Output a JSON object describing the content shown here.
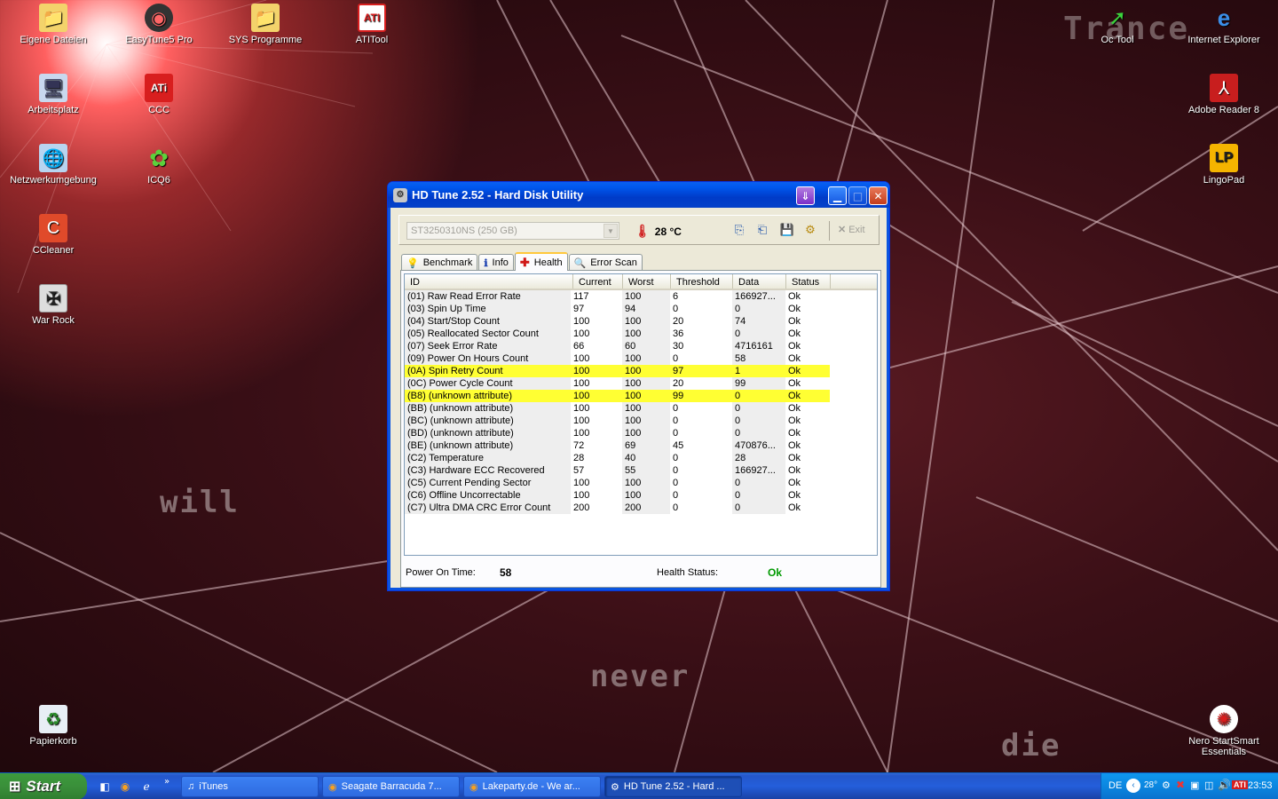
{
  "wallpaper": {
    "words": [
      "will",
      "never",
      "die"
    ],
    "top_word": "Trance"
  },
  "desktop_icons_left": [
    {
      "label": "Eigene Dateien",
      "icon": "folder-documents-icon"
    },
    {
      "label": "Arbeitsplatz",
      "icon": "computer-icon"
    },
    {
      "label": "Netzwerkumgebung",
      "icon": "network-icon"
    },
    {
      "label": "CCleaner",
      "icon": "ccleaner-icon"
    },
    {
      "label": "War Rock",
      "icon": "war-rock-icon"
    },
    {
      "label": "Papierkorb",
      "icon": "recycle-bin-icon"
    }
  ],
  "desktop_icons_col2": [
    {
      "label": "EasyTune5 Pro",
      "icon": "easytune-icon"
    },
    {
      "label": "CCC",
      "icon": "ati-ccc-icon"
    },
    {
      "label": "ICQ6",
      "icon": "icq-icon"
    }
  ],
  "desktop_icons_top": [
    {
      "label": "SYS Programme",
      "icon": "folder-icon"
    },
    {
      "label": "ATITool",
      "icon": "atitool-icon"
    }
  ],
  "desktop_icons_right": [
    {
      "label": "Oc Tool",
      "icon": "oc-tool-icon"
    },
    {
      "label": "Internet Explorer",
      "icon": "internet-explorer-icon"
    },
    {
      "label": "Adobe Reader 8",
      "icon": "adobe-reader-icon"
    },
    {
      "label": "LingoPad",
      "icon": "lingopad-icon"
    },
    {
      "label": "Nero StartSmart Essentials",
      "icon": "nero-icon"
    }
  ],
  "window": {
    "title": "HD Tune 2.52 - Hard Disk Utility",
    "drive": "ST3250310NS (250 GB)",
    "temperature": "28 °C",
    "exit_label": "Exit",
    "tabs": [
      {
        "label": "Benchmark",
        "icon": "benchmark-icon",
        "active": false
      },
      {
        "label": "Info",
        "icon": "info-icon",
        "active": false
      },
      {
        "label": "Health",
        "icon": "health-cross-icon",
        "active": true
      },
      {
        "label": "Error Scan",
        "icon": "error-scan-icon",
        "active": false
      }
    ],
    "columns": [
      "ID",
      "Current",
      "Worst",
      "Threshold",
      "Data",
      "Status"
    ],
    "rows": [
      {
        "id": "(01) Raw Read Error Rate",
        "current": "117",
        "worst": "100",
        "threshold": "6",
        "data": "166927...",
        "status": "Ok",
        "highlight": false
      },
      {
        "id": "(03) Spin Up Time",
        "current": "97",
        "worst": "94",
        "threshold": "0",
        "data": "0",
        "status": "Ok",
        "highlight": false
      },
      {
        "id": "(04) Start/Stop Count",
        "current": "100",
        "worst": "100",
        "threshold": "20",
        "data": "74",
        "status": "Ok",
        "highlight": false
      },
      {
        "id": "(05) Reallocated Sector Count",
        "current": "100",
        "worst": "100",
        "threshold": "36",
        "data": "0",
        "status": "Ok",
        "highlight": false
      },
      {
        "id": "(07) Seek Error Rate",
        "current": "66",
        "worst": "60",
        "threshold": "30",
        "data": "4716161",
        "status": "Ok",
        "highlight": false
      },
      {
        "id": "(09) Power On Hours Count",
        "current": "100",
        "worst": "100",
        "threshold": "0",
        "data": "58",
        "status": "Ok",
        "highlight": false
      },
      {
        "id": "(0A) Spin Retry Count",
        "current": "100",
        "worst": "100",
        "threshold": "97",
        "data": "1",
        "status": "Ok",
        "highlight": true
      },
      {
        "id": "(0C) Power Cycle Count",
        "current": "100",
        "worst": "100",
        "threshold": "20",
        "data": "99",
        "status": "Ok",
        "highlight": false
      },
      {
        "id": "(B8) (unknown attribute)",
        "current": "100",
        "worst": "100",
        "threshold": "99",
        "data": "0",
        "status": "Ok",
        "highlight": true
      },
      {
        "id": "(BB) (unknown attribute)",
        "current": "100",
        "worst": "100",
        "threshold": "0",
        "data": "0",
        "status": "Ok",
        "highlight": false
      },
      {
        "id": "(BC) (unknown attribute)",
        "current": "100",
        "worst": "100",
        "threshold": "0",
        "data": "0",
        "status": "Ok",
        "highlight": false
      },
      {
        "id": "(BD) (unknown attribute)",
        "current": "100",
        "worst": "100",
        "threshold": "0",
        "data": "0",
        "status": "Ok",
        "highlight": false
      },
      {
        "id": "(BE) (unknown attribute)",
        "current": "72",
        "worst": "69",
        "threshold": "45",
        "data": "470876...",
        "status": "Ok",
        "highlight": false
      },
      {
        "id": "(C2) Temperature",
        "current": "28",
        "worst": "40",
        "threshold": "0",
        "data": "28",
        "status": "Ok",
        "highlight": false
      },
      {
        "id": "(C3) Hardware ECC Recovered",
        "current": "57",
        "worst": "55",
        "threshold": "0",
        "data": "166927...",
        "status": "Ok",
        "highlight": false
      },
      {
        "id": "(C5) Current Pending Sector",
        "current": "100",
        "worst": "100",
        "threshold": "0",
        "data": "0",
        "status": "Ok",
        "highlight": false
      },
      {
        "id": "(C6) Offline Uncorrectable",
        "current": "100",
        "worst": "100",
        "threshold": "0",
        "data": "0",
        "status": "Ok",
        "highlight": false
      },
      {
        "id": "(C7) Ultra DMA CRC Error Count",
        "current": "200",
        "worst": "200",
        "threshold": "0",
        "data": "0",
        "status": "Ok",
        "highlight": false
      }
    ],
    "footer": {
      "power_on_label": "Power On Time:",
      "power_on_value": "58",
      "health_label": "Health Status:",
      "health_value": "Ok"
    }
  },
  "taskbar": {
    "start_label": "Start",
    "tasks": [
      {
        "label": "iTunes",
        "icon": "itunes-icon",
        "active": false
      },
      {
        "label": "Seagate Barracuda 7...",
        "icon": "firefox-icon",
        "active": false
      },
      {
        "label": "Lakeparty.de - We ar...",
        "icon": "firefox-icon",
        "active": false
      },
      {
        "label": "HD Tune 2.52 - Hard ...",
        "icon": "hdtune-icon",
        "active": true
      }
    ],
    "tray": {
      "language": "DE",
      "temp": "28°",
      "clock": "23:53"
    }
  },
  "colors": {
    "highlight_row": "#ffff33",
    "health_ok": "#009900",
    "title_bar": "#0058ee"
  }
}
